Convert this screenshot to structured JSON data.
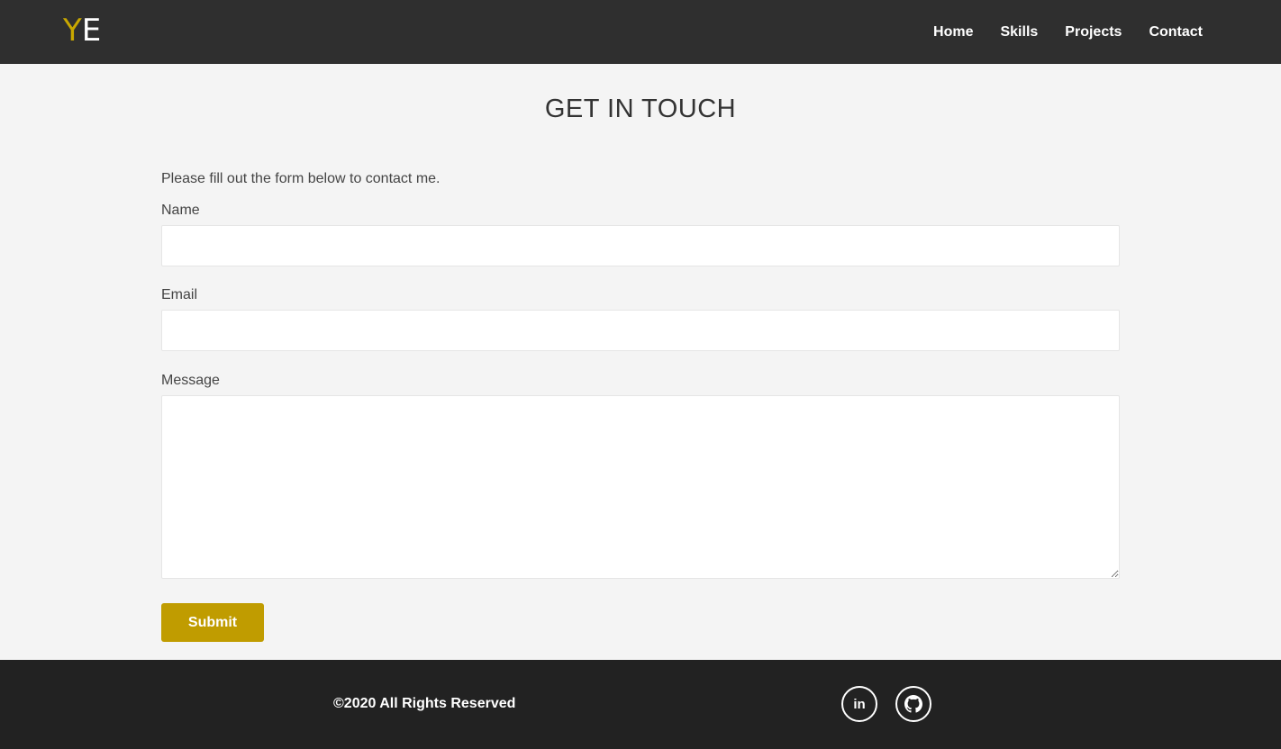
{
  "header": {
    "logo": {
      "first": "Y",
      "second": "E"
    },
    "nav": [
      {
        "label": "Home"
      },
      {
        "label": "Skills"
      },
      {
        "label": "Projects"
      },
      {
        "label": "Contact"
      }
    ]
  },
  "main": {
    "title": "GET IN TOUCH",
    "intro": "Please fill out the form below to contact me.",
    "form": {
      "name_label": "Name",
      "name_value": "",
      "email_label": "Email",
      "email_value": "",
      "message_label": "Message",
      "message_value": "",
      "submit_label": "Submit"
    }
  },
  "footer": {
    "copyright": "©2020 All Rights Reserved",
    "social": [
      {
        "icon": "linkedin-icon",
        "text": "in"
      },
      {
        "icon": "github-icon"
      }
    ]
  },
  "colors": {
    "header_bg": "#2f2f2f",
    "page_bg": "#f4f4f4",
    "accent": "#c09c00",
    "logo_accent": "#c9a800",
    "footer_bg": "#222222"
  }
}
